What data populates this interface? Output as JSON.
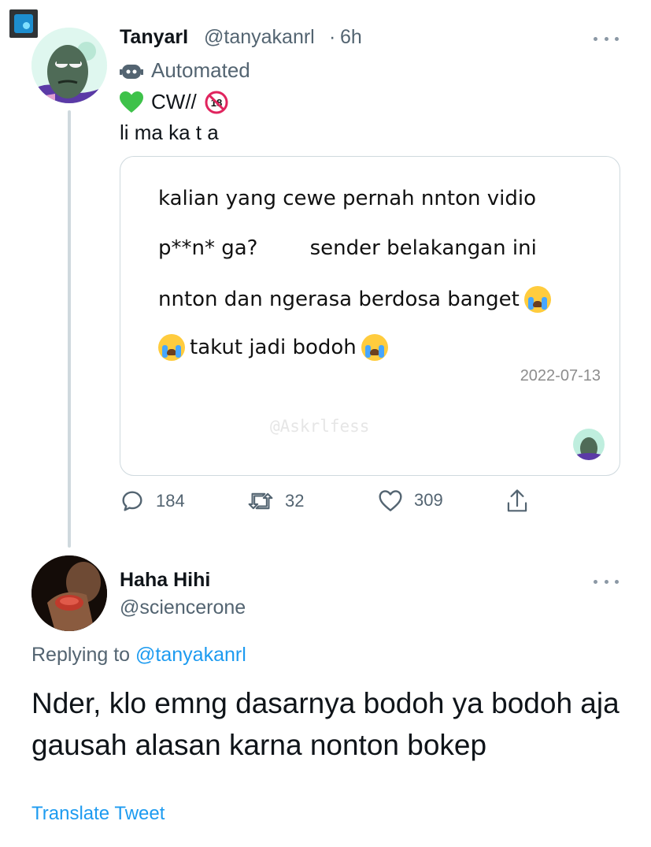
{
  "tweet": {
    "author_name": "TanyarI",
    "author_handle": "@tanyakanrl",
    "separator": "·",
    "time": "6h",
    "automated_label": "Automated",
    "cw_label": "CW//",
    "text": "li ma ka t a",
    "card": {
      "lines": [
        "kalian yang cewe pernah nnton vidio",
        "p**n* ga?        sender belakangan ini",
        "nnton dan ngerasa berdosa banget",
        "takut jadi bodoh"
      ],
      "date": "2022-07-13",
      "watermark": "@Askrlfess"
    },
    "stats": {
      "replies": "184",
      "retweets": "32",
      "likes": "309"
    }
  },
  "reply": {
    "author_name": "Haha Hihi",
    "author_handle": "@sciencerone",
    "replying_prefix": "Replying to",
    "replying_to": "@tanyakanrl",
    "text": "Nder, klo emng dasarnya bodoh ya bodoh aja gausah alasan karna nonton bokep",
    "translate_label": "Translate Tweet"
  },
  "colors": {
    "link": "#1d9bf0",
    "secondary_text": "#536471",
    "border": "#cfd9de"
  },
  "icons": [
    "robot-icon",
    "green-heart-icon",
    "no-under-18-icon",
    "crying-face-icon",
    "reply-icon",
    "retweet-icon",
    "like-icon",
    "share-icon",
    "more-icon"
  ]
}
